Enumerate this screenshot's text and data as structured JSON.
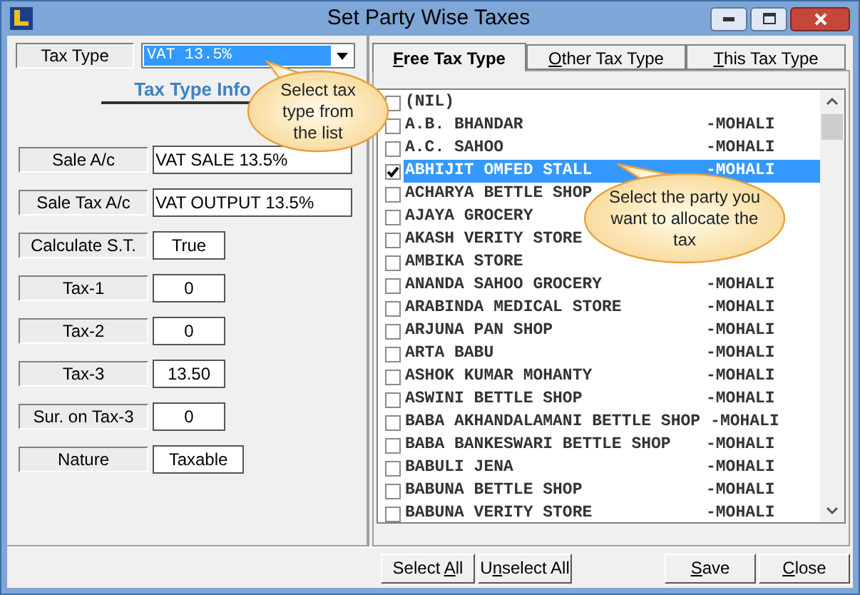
{
  "window": {
    "title": "Set Party Wise Taxes"
  },
  "tax_type": {
    "label": "Tax Type",
    "value": "VAT 13.5%"
  },
  "section_title": "Tax Type Info",
  "fields": [
    {
      "label": "Sale A/c",
      "value": "VAT SALE 13.5%",
      "kind": "wide"
    },
    {
      "label": "Sale Tax A/c",
      "value": "VAT OUTPUT 13.5%",
      "kind": "wide"
    },
    {
      "label": "Calculate S.T.",
      "value": "True",
      "kind": "short"
    },
    {
      "label": "Tax-1",
      "value": "0",
      "kind": "short"
    },
    {
      "label": "Tax-2",
      "value": "0",
      "kind": "short"
    },
    {
      "label": "Tax-3",
      "value": "13.50",
      "kind": "short"
    },
    {
      "label": "Sur. on Tax-3",
      "value": "0",
      "kind": "short"
    },
    {
      "label": "Nature",
      "value": "Taxable",
      "kind": "medium"
    }
  ],
  "tabs": [
    {
      "mnemonic": "F",
      "rest": "ree Tax Type",
      "selected": true
    },
    {
      "mnemonic": "O",
      "rest": "ther Tax Type",
      "selected": false
    },
    {
      "mnemonic": "T",
      "rest": "his Tax Type",
      "selected": false
    }
  ],
  "parties": [
    {
      "name": "(NIL)",
      "checked": false,
      "selected": false
    },
    {
      "name": "A.B. BHANDAR",
      "city": "-MOHALI",
      "checked": false,
      "selected": false
    },
    {
      "name": "A.C. SAHOO",
      "city": "-MOHALI",
      "checked": false,
      "selected": false
    },
    {
      "name": "ABHIJIT OMFED STALL",
      "city": "-MOHALI",
      "checked": true,
      "selected": true
    },
    {
      "name": "ACHARYA BETTLE SHOP",
      "checked": false,
      "selected": false
    },
    {
      "name": "AJAYA GROCERY",
      "checked": false,
      "selected": false
    },
    {
      "name": "AKASH VERITY STORE",
      "checked": false,
      "selected": false
    },
    {
      "name": "AMBIKA STORE",
      "checked": false,
      "selected": false
    },
    {
      "name": "ANANDA SAHOO GROCERY",
      "city": "-MOHALI",
      "checked": false,
      "selected": false
    },
    {
      "name": "ARABINDA MEDICAL STORE",
      "city": "-MOHALI",
      "checked": false,
      "selected": false
    },
    {
      "name": "ARJUNA PAN SHOP",
      "city": "-MOHALI",
      "checked": false,
      "selected": false
    },
    {
      "name": "ARTA BABU",
      "city": "-MOHALI",
      "checked": false,
      "selected": false
    },
    {
      "name": "ASHOK KUMAR MOHANTY",
      "city": "-MOHALI",
      "checked": false,
      "selected": false
    },
    {
      "name": "ASWINI BETTLE SHOP",
      "city": "-MOHALI",
      "checked": false,
      "selected": false
    },
    {
      "name": "BABA AKHANDALAMANI BETTLE SHOP",
      "city": "-MOHALI",
      "checked": false,
      "selected": false
    },
    {
      "name": "BABA BANKESWARI BETTLE SHOP",
      "city": "-MOHALI",
      "checked": false,
      "selected": false
    },
    {
      "name": "BABULI JENA",
      "city": "-MOHALI",
      "checked": false,
      "selected": false
    },
    {
      "name": "BABUNA BETTLE SHOP",
      "city": "-MOHALI",
      "checked": false,
      "selected": false
    },
    {
      "name": "BABUNA VERITY STORE",
      "city": "-MOHALI",
      "checked": false,
      "selected": false
    }
  ],
  "buttons": [
    {
      "before": "Select ",
      "mnemonic": "A",
      "after": "ll"
    },
    {
      "before": "U",
      "mnemonic": "n",
      "after": "select All"
    },
    {
      "mnemonic": "S",
      "after": "ave"
    },
    {
      "mnemonic": "C",
      "after": "lose"
    }
  ],
  "callouts": [
    {
      "text": "Select tax type from the list"
    },
    {
      "text": "Select the party you want to allocate the tax"
    }
  ]
}
